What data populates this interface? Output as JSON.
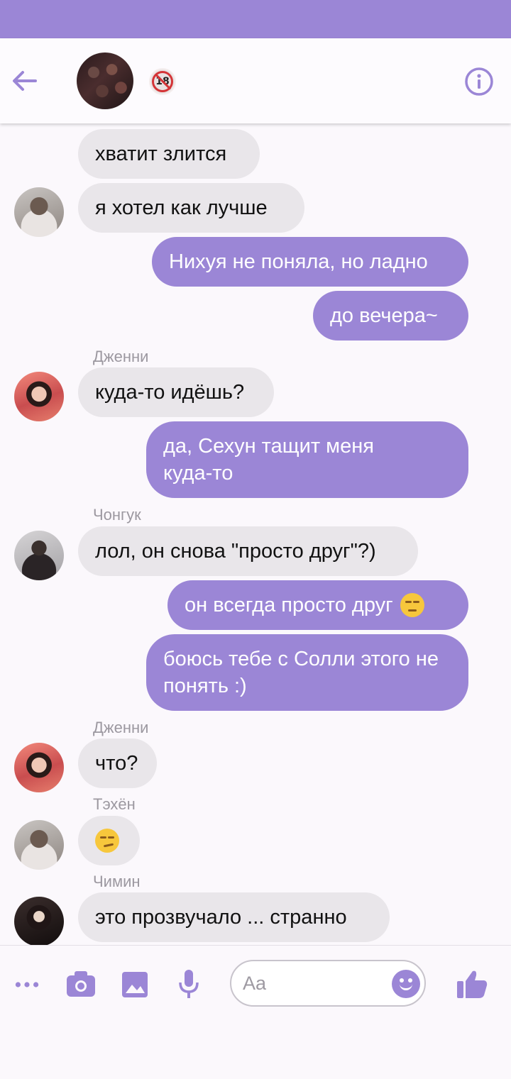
{
  "header": {
    "back_icon": "arrow-left-icon",
    "badge_text": "18",
    "info_icon": "info-icon"
  },
  "colors": {
    "accent": "#9b86d6",
    "incoming": "#e9e6ea",
    "outgoing_text": "#ffffff"
  },
  "messages": [
    {
      "text": "хватит злится"
    },
    {
      "text": "я хотел как лучше"
    },
    {
      "text": "Нихуя не поняла, но ладно"
    },
    {
      "text": "до вечера~"
    },
    {
      "sender": "Дженни",
      "text": "куда-то идёшь?"
    },
    {
      "text": "да, Сехун тащит меня куда-то"
    },
    {
      "sender": "Чонгук",
      "text": "лол, он снова \"просто друг\"?)"
    },
    {
      "text": "он всегда просто друг",
      "emoji": "unamused-face"
    },
    {
      "text": "боюсь тебе с Солли этого не понять :)"
    },
    {
      "sender": "Дженни",
      "text": "что?"
    },
    {
      "sender": "Тэхён",
      "emoji": "smirking-face"
    },
    {
      "sender": "Чимин",
      "text": "это прозвучало ... странно"
    }
  ],
  "composer": {
    "placeholder": "Aa",
    "icons": [
      "more-dots-icon",
      "camera-icon",
      "image-icon",
      "microphone-icon",
      "emoji-icon",
      "thumbs-up-icon"
    ]
  }
}
